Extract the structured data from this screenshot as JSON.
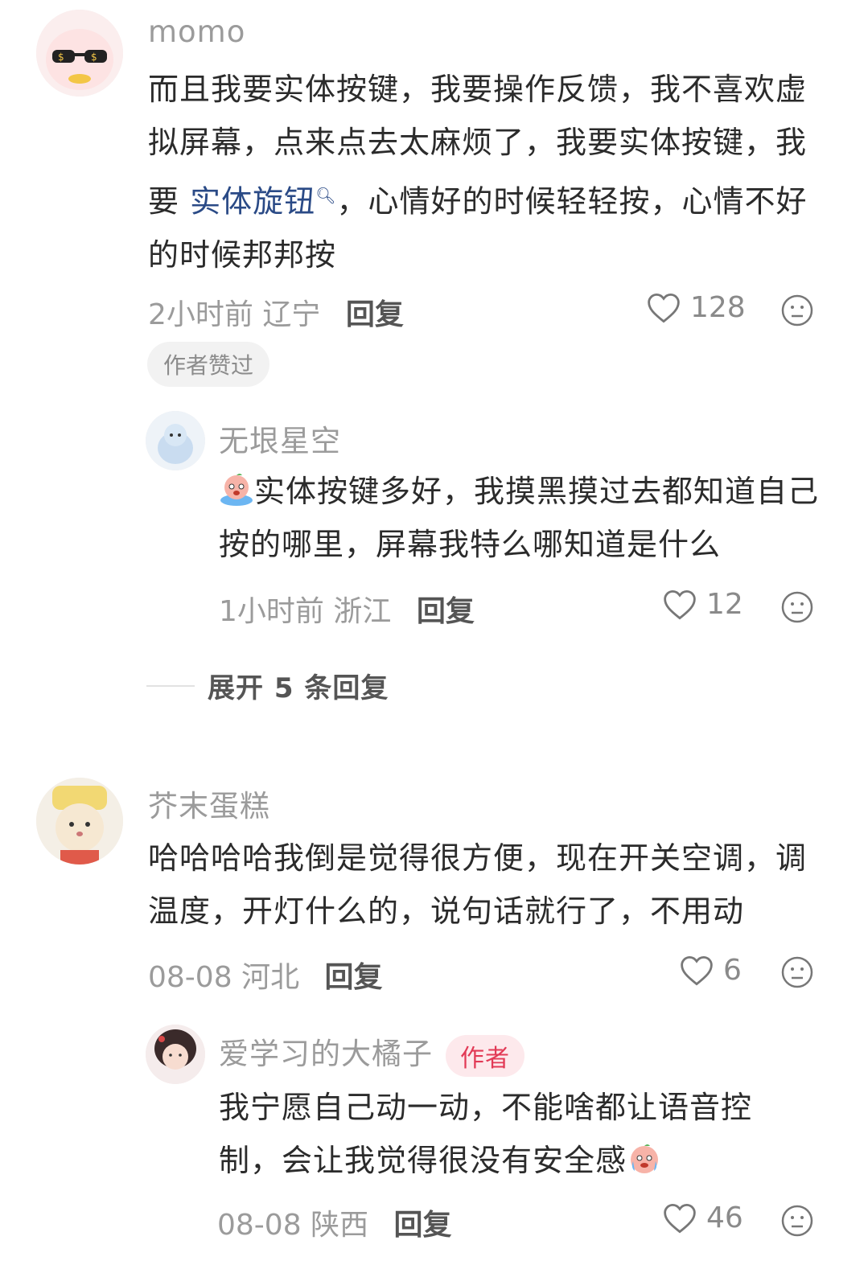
{
  "comments": [
    {
      "username": "momo",
      "text_before": "而且我要实体按键，我要操作反馈，我不喜欢虚拟屏幕，点来点去太麻烦了，我要实体按键，我要 ",
      "link": "实体旋钮",
      "text_after": "，心情好的时候轻轻按，心情不好的时候邦邦按",
      "time": "2小时前",
      "location": "辽宁",
      "reply_label": "回复",
      "likes": "128",
      "tag": "作者赞过",
      "replies": [
        {
          "username": "无垠星空",
          "text": "实体按键多好，我摸黑摸过去都知道自己按的哪里，屏幕我特么哪知道是什么",
          "time": "1小时前",
          "location": "浙江",
          "reply_label": "回复",
          "likes": "12"
        }
      ],
      "expand_label": "展开 5 条回复"
    },
    {
      "username": "芥末蛋糕",
      "text": "哈哈哈哈我倒是觉得很方便，现在开关空调，调温度，开灯什么的，说句话就行了，不用动",
      "time": "08-08",
      "location": "河北",
      "reply_label": "回复",
      "likes": "6",
      "replies": [
        {
          "username": "爱学习的大橘子",
          "badge": "作者",
          "text": "我宁愿自己动一动，不能啥都让语音控制，会让我觉得很没有安全感",
          "time": "08-08",
          "location": "陕西",
          "reply_label": "回复",
          "likes": "46"
        }
      ]
    }
  ],
  "colors": {
    "link": "#2a4a86",
    "author_badge_bg": "#fde9ec",
    "author_badge_text": "#e23a56"
  },
  "icons": {
    "like": "heart-outline-icon",
    "dislike": "neutral-face-icon"
  }
}
